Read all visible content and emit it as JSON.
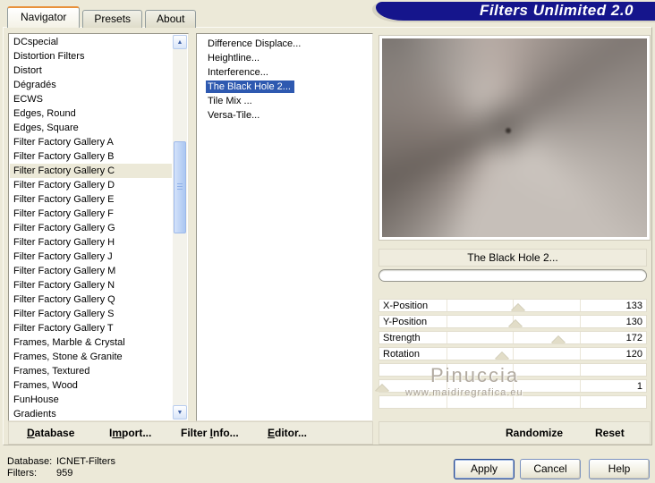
{
  "colors": {
    "titlebar_blue": "#15158C",
    "selection_blue": "#2E59B0",
    "tab_accent_orange": "#E8913C",
    "background_beige": "#ECE9D8"
  },
  "titlebar": {
    "title": "Filters Unlimited 2.0"
  },
  "tabs": [
    {
      "label": "Navigator",
      "active": true
    },
    {
      "label": "Presets",
      "active": false
    },
    {
      "label": "About",
      "active": false
    }
  ],
  "category_list": {
    "selected": "Filter Factory Gallery C",
    "items": [
      "DCspecial",
      "Distortion Filters",
      "Distort",
      "Dégradés",
      "ECWS",
      "Edges, Round",
      "Edges, Square",
      "Filter Factory Gallery A",
      "Filter Factory Gallery B",
      "Filter Factory Gallery C",
      "Filter Factory Gallery D",
      "Filter Factory Gallery E",
      "Filter Factory Gallery F",
      "Filter Factory Gallery G",
      "Filter Factory Gallery H",
      "Filter Factory Gallery J",
      "Filter Factory Gallery M",
      "Filter Factory Gallery N",
      "Filter Factory Gallery Q",
      "Filter Factory Gallery S",
      "Filter Factory Gallery T",
      "Frames, Marble & Crystal",
      "Frames, Stone & Granite",
      "Frames, Textured",
      "Frames, Wood",
      "FunHouse",
      "Gradients"
    ]
  },
  "filter_list": {
    "selected": "The Black Hole 2...",
    "items": [
      "Difference Displace...",
      "Heightline...",
      "Interference...",
      "The Black Hole 2...",
      "Tile Mix ...",
      "Versa-Tile..."
    ]
  },
  "preview": {
    "caption": "The Black Hole 2...",
    "progress_percent": 0
  },
  "parameters": {
    "rows": [
      {
        "label": "X-Position",
        "value": "133",
        "marker_pct": 52
      },
      {
        "label": "Y-Position",
        "value": "130",
        "marker_pct": 51
      },
      {
        "label": "Strength",
        "value": "172",
        "marker_pct": 67
      },
      {
        "label": "Rotation",
        "value": "120",
        "marker_pct": 46
      },
      {
        "label": "",
        "value": "",
        "marker_pct": null
      },
      {
        "label": "",
        "value": "1",
        "marker_pct": 1
      },
      {
        "label": "",
        "value": "",
        "marker_pct": null
      }
    ]
  },
  "watermark": {
    "name": "Pinuccia",
    "url": "www.maidiregrafica.eu"
  },
  "toolbar": {
    "left": [
      {
        "pre": "",
        "key": "D",
        "post": "atabase"
      },
      {
        "pre": "I",
        "key": "m",
        "post": "port..."
      },
      {
        "pre": "Filter ",
        "key": "I",
        "post": "nfo..."
      },
      {
        "pre": "",
        "key": "E",
        "post": "ditor..."
      }
    ],
    "right": [
      {
        "pre": "Randomize",
        "key": "",
        "post": ""
      },
      {
        "pre": "Reset",
        "key": "",
        "post": ""
      }
    ]
  },
  "status": {
    "rows": [
      {
        "label": "Database:",
        "value": "ICNET-Filters"
      },
      {
        "label": "Filters:",
        "value": "959"
      }
    ]
  },
  "action_buttons": [
    {
      "label": "Apply",
      "default": true
    },
    {
      "label": "Cancel",
      "default": false
    },
    {
      "label": "Help",
      "default": false
    }
  ],
  "scrollbar": {
    "up_glyph": "▲",
    "down_glyph": "▼"
  }
}
